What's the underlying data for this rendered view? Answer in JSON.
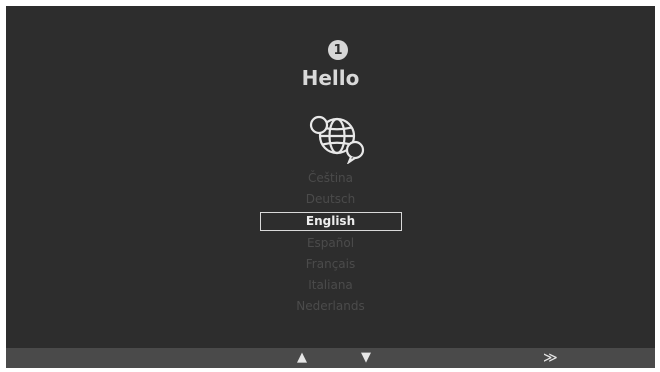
{
  "step": {
    "number": "1"
  },
  "title": "Hello",
  "languages": {
    "items": [
      "Čeština",
      "Deutsch",
      "English",
      "Español",
      "Français",
      "Italiana",
      "Nederlands"
    ],
    "selected_index": 2
  },
  "icons": {
    "globe": "globe-chat-icon",
    "up": "arrow-up-icon",
    "down": "arrow-down-icon",
    "next": "double-chevron-right-icon"
  },
  "bottom_bar": {
    "up_glyph": "▲",
    "down_glyph": "▼",
    "next_glyph": "≫"
  },
  "colors": {
    "background": "#2d2d2d",
    "text_active": "#ededed",
    "text_dim": "#4b4b4b",
    "bar": "#4a4a4a"
  }
}
